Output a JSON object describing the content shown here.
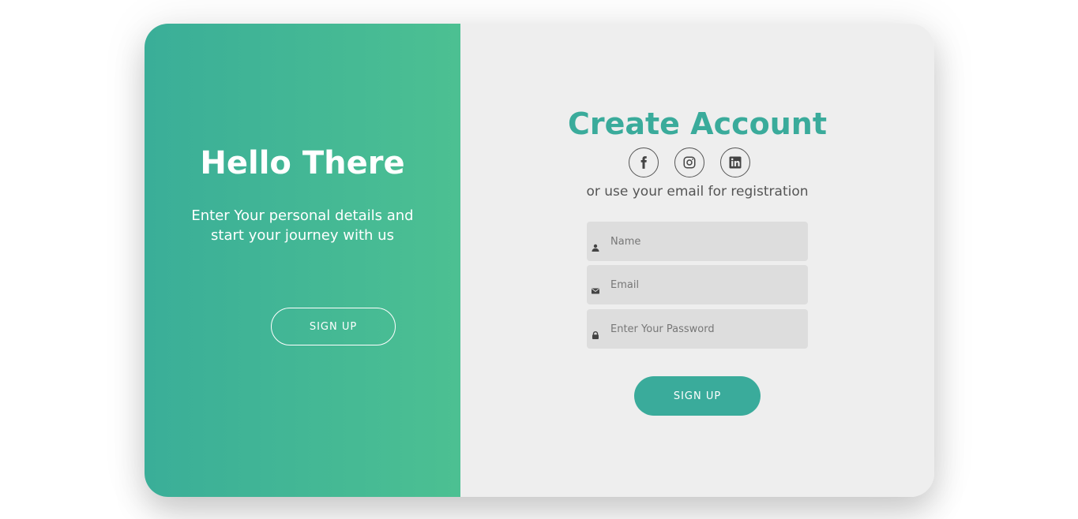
{
  "left_panel": {
    "title": "Hello There",
    "text": "Enter Your personal details and start your journey with us",
    "button_label": "SIGN UP"
  },
  "right_panel": {
    "title": "Create Account",
    "socials": [
      {
        "name": "facebook-icon"
      },
      {
        "name": "instagram-icon"
      },
      {
        "name": "linkedin-icon"
      }
    ],
    "sub_text": "or use your email for registration",
    "fields": {
      "name": {
        "placeholder": "Name",
        "icon": "user-icon"
      },
      "email": {
        "placeholder": "Email",
        "icon": "envelope-icon"
      },
      "password": {
        "placeholder": "Enter Your Password",
        "icon": "lock-icon"
      }
    },
    "button_label": "SIGN UP"
  },
  "colors": {
    "accent": "#3aab9b",
    "gradient_start": "#3aae98",
    "gradient_end": "#4cc092",
    "panel_background": "#eeeeee",
    "field_background": "#dddddd"
  }
}
